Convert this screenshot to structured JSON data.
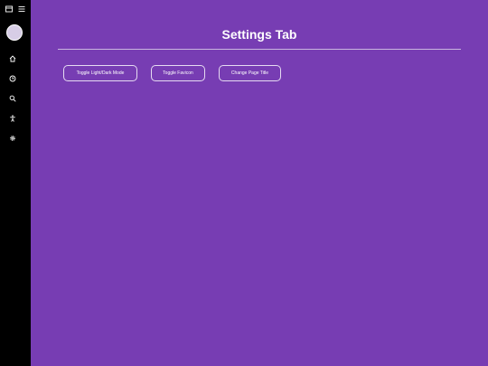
{
  "page": {
    "title": "Settings Tab"
  },
  "buttons": {
    "toggle_theme": "Toggle Light/Dark Mode",
    "toggle_favicon": "Toggle Favicon",
    "change_title": "Change Page Title"
  },
  "icons": {
    "top": [
      "window-icon",
      "hamburger-menu-icon"
    ],
    "nav": [
      "home-icon",
      "clock-icon",
      "search-icon",
      "accessibility-icon",
      "gear-icon"
    ]
  },
  "colors": {
    "background": "#773db3",
    "sidebar": "#000000",
    "text": "#ffffff"
  }
}
